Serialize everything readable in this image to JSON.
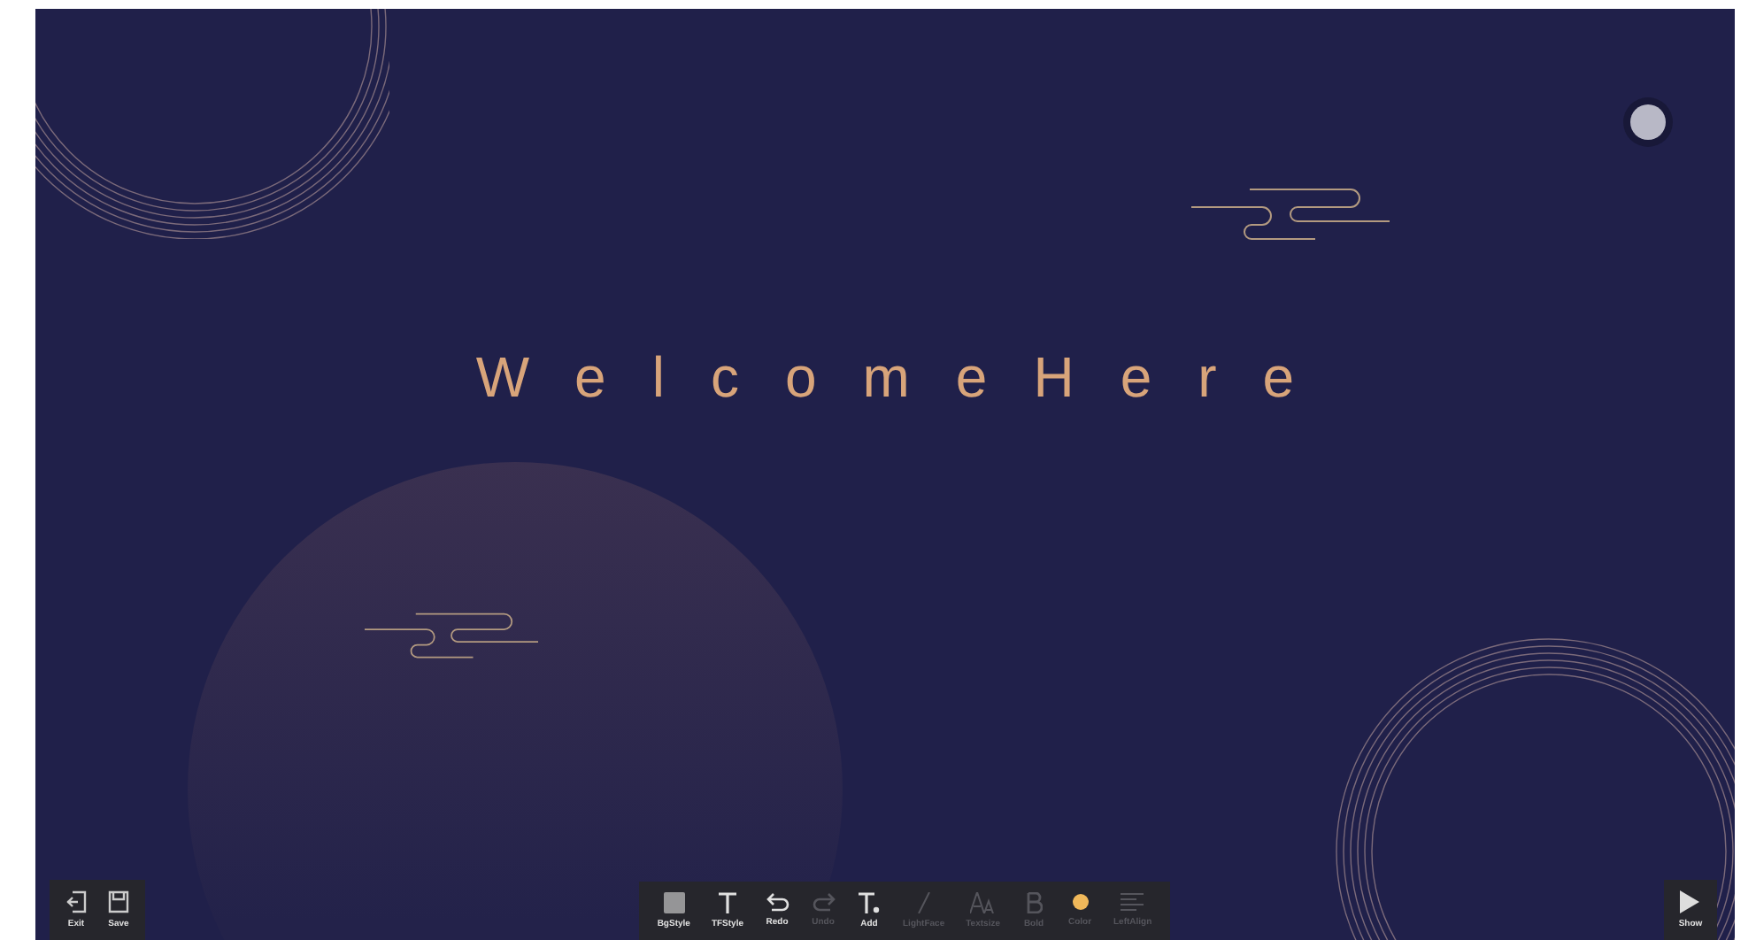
{
  "title": "WelcomeHere",
  "left_tools": [
    {
      "label": "Exit",
      "kind": "exit"
    },
    {
      "label": "Save",
      "kind": "save"
    }
  ],
  "tools": [
    {
      "label": "BgStyle",
      "kind": "square",
      "disabled": false
    },
    {
      "label": "TFStyle",
      "kind": "text",
      "disabled": false
    },
    {
      "label": "Redo",
      "kind": "back",
      "disabled": false
    },
    {
      "label": "Undo",
      "kind": "forward",
      "disabled": true
    },
    {
      "label": "Add",
      "kind": "addtext",
      "disabled": false
    },
    {
      "label": "LightFace",
      "kind": "slash",
      "disabled": true
    },
    {
      "label": "Textsize",
      "kind": "textsize",
      "disabled": true
    },
    {
      "label": "Bold",
      "kind": "bold",
      "disabled": true
    },
    {
      "label": "Color",
      "kind": "swatch",
      "disabled": true,
      "color": "#f0b85a"
    },
    {
      "label": "LeftAlign",
      "kind": "lines",
      "disabled": true
    }
  ],
  "show_button": {
    "label": "Show"
  }
}
